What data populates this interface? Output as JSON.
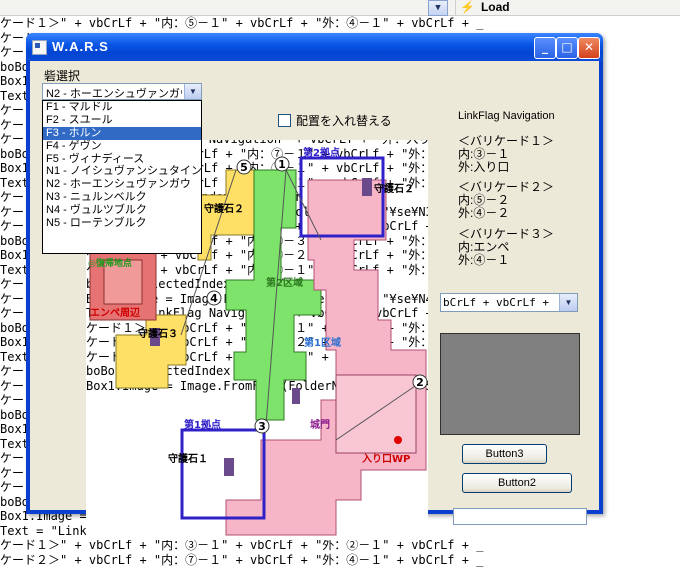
{
  "code_lines": [
    "ケード１＞\" + vbCrLf + \"内：⑤－１\" + vbCrLf + \"外：④－１\" + vbCrLf + _",
    "ケード２",
    "ケード３",
    "boBox1.",
    "Box1.Im",
    "Text = ",
    "ケード１＞\" + vbCrLf + \"内：⑤－１\" + vbCrLf + \"外：④－１\" + vbCrLf +",
    "ケード２＞\" + vbCrLf + \"内：⑤－２\" + vbCrLf + \"外：④－２\" + vbCrLf +",
    "ケード３＞\" + vbCrLf + \"内：エンペ\" + vbCrLf + \"外：④－１\" + vbCrLf +",
    "boBox1.",
    "Box1.Im",
    "Text = ",
    "ケード１",
    "ケード２＞\" + vbCrLf + \"内：⑤－２\" + vbCrLf + \"外：④－２\" + vbCrLf +",
    "ケード３＞\" + vbCrLf + \"内：⑤－１\" + vbCrLf + \"外：⑥－１\" + vbCrLf +",
    "boBox1.SelectedIndex = 6) Then",
    "Box1.Image = Image.FromFile(FolderName + \"¥se¥N2.png\")",
    "Text = \"LinkFlag Navigation\" + vbCrLf + \"外：入り口\" + vbCrLf +",
    "ケード１＞\" + vbCrLf + \"内：⑦－１\" + vbCrLf + \"外：⑤－２\" + vbCrLf +",
    "ケード２＞\" + vbCrLf + \"内：⑦－１\" + vbCrLf + \"外：⑤－２\" + vbCrLf +",
    "ケード３＞\" + vbCrLf + \"内：⑦－１\" + vbCrLf + \"外：⑤－１\" + vbCrLf +",
    "boBox1.SelectedIndex = 7) Then",
    "Box1.Image = Image.FromFile(FolderName + \"¥se¥N3.png\")",
    "Text = \"LinkFlag Navigation\" + vbCrLf + vbCrLf + _",
    "ケード１＞\" + vbCrLf + \"内：⑥－３\" + vbCrLf + \"外：⑦－１\" + vbCrLf +",
    "ケード２＞\" + vbCrLf + \"内：⑨－２\" + vbCrLf + \"外：⑨－２\" + vbCrLf +",
    "ケード３＞\" + vbCrLf + \"内：⑥－１\" + vbCrLf + \"外：⑥－１\" + vbCrLf +",
    "boBox1.SelectedIndex = 8) Then",
    "Box1.Image = Image.FromFile(FolderName + \"¥se¥N4.png\")",
    "Text = \"LinkFlag Navigation\" + vbCrLf + vbCrLf + _",
    "ケード１＞\" + vbCrLf + \"内：②－１\" + vbCrLf + \"外：②－１\" + vbCrLf +",
    "ケード２＞\" + vbCrLf + \"内：⑦－２\" + vbCrLf + \"外：⑦－２\" + vbCrLf +",
    "ケード３＞\" + vbCrLf + \"内：エンペ\" + vbCrLf + \"外：⑥－１\" + vbCrLf +",
    "boBox1.SelectedIndex = 9) Then",
    "Box1.Image = Image.FromFile(FolderName + \"¥se¥N5.png\")",
    "Text = \"LinkFlag Navigation\" + vbCrLf + vbCrLf + _",
    "ケード１＞\" + vbCrLf + \"内：③－１\" + vbCrLf + \"外：②－１\" + vbCrLf + _",
    "ケード２＞\" + vbCrLf + \"内：⑦－１\" + vbCrLf + \"外：④－１\" + vbCrLf + _"
  ],
  "topbar": {
    "load_label": "Load"
  },
  "window": {
    "title": "W.A.R.S",
    "minimize": "_",
    "maximize": "□",
    "close": "✕"
  },
  "form": {
    "select_label": "砦選択",
    "combo_value": "N2 - ホーエンシュヴァンガウ",
    "options": [
      "F1 - マルドル",
      "F2 - スユール",
      "F3 - ホルン",
      "F4 - ゲヴン",
      "F5 - ヴィナディース",
      "N1 - ノイシュヴァンシュタイン",
      "N2 - ホーエンシュヴァンガウ",
      "N3 - ニュルンベルク",
      "N4 - ヴュルツブルク",
      "N5 - ローテンブルク"
    ],
    "selected_index": 2,
    "checkbox_label": "配置を入れ替える"
  },
  "nav": {
    "title": "LinkFlag Navigation",
    "barricade1": "＜バリケード１＞\n内:③－１\n外:入り口",
    "barricade2": "＜バリケード２＞\n内:⑤－２\n外:④－２",
    "barricade3": "＜バリケード３＞\n内:エンペ\n外:④－１"
  },
  "combo2_value": "bCrLf + vbCrLf +",
  "button3_label": "Button3",
  "button2_label": "Button2",
  "map": {
    "labels": {
      "base2": "第2拠点",
      "guard2": "守護石２",
      "zone2": "第2区域",
      "zone1": "第1区域",
      "base1": "第1拠点",
      "guard1": "守護石１",
      "entrance": "入り口WP",
      "castle_gate": "城門",
      "revive": "◎復帰地点",
      "empe_area": "エンペ周辺",
      "guard3": "守護石３",
      "guard2b": "守護石２"
    },
    "markers": [
      "5",
      "1",
      "2",
      "3",
      "4"
    ]
  },
  "colors": {
    "title_blue": "#0a56e6",
    "select_blue": "#316ac5",
    "zone_pink": "#f6b6c8",
    "zone_green": "#7ee36b",
    "zone_yellow": "#ffe066",
    "zone_red": "#e57373",
    "base_border": "#3020c8"
  }
}
